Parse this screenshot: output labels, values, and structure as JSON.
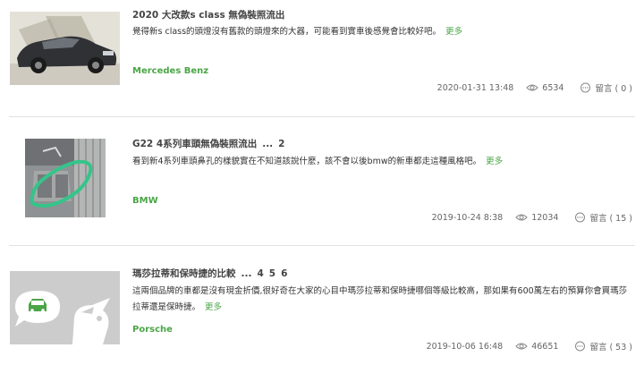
{
  "posts": [
    {
      "title": "2020 大改款s class 無偽裝照流出",
      "excerpt": "覺得新s class的頭燈沒有舊款的頭燈來的大器，可能看到實車後感覺會比較好吧。",
      "more": "更多",
      "brand": "Mercedes Benz",
      "date": "2020-01-31 13:48",
      "views": "6534",
      "comments": "留言 ( 0 )"
    },
    {
      "title": "G22 4系列車頭無偽裝照流出",
      "pages": [
        "...",
        "2"
      ],
      "excerpt": "看到新4系列車頭鼻孔的樣貌實在不知道該說什麼，該不會以後bmw的新車都走這種風格吧。",
      "more": "更多",
      "brand": "BMW",
      "date": "2019-10-24 8:38",
      "views": "12034",
      "comments": "留言 ( 15 )"
    },
    {
      "title": "瑪莎拉蒂和保時捷的比較",
      "pages": [
        "...",
        "4",
        "5",
        "6"
      ],
      "excerpt": "這兩個品牌的車都是沒有現金折價,很好奇在大家的心目中瑪莎拉蒂和保時捷哪個等級比較高，那如果有600萬左右的預算你會買瑪莎拉蒂還是保時捷。",
      "more": "更多",
      "brand": "Porsche",
      "date": "2019-10-06 16:48",
      "views": "46651",
      "comments": "留言 ( 53 )"
    }
  ],
  "colors": {
    "accent": "#4aa546",
    "divider": "#e2e2e2",
    "placeholder": "#cccccc"
  },
  "icons": {
    "views": "eye-icon",
    "comments": "chat-bubble-icon",
    "placeholder": "car-speech-bubble-icon"
  }
}
